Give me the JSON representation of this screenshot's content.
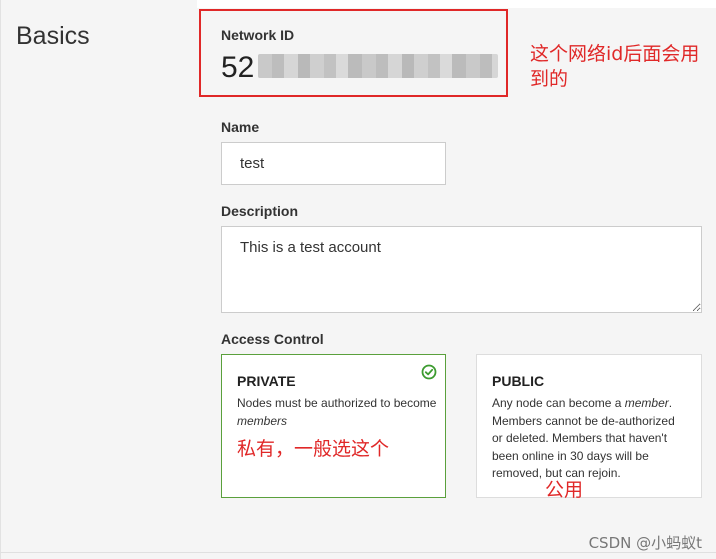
{
  "section": {
    "title": "Basics"
  },
  "network_id": {
    "label": "Network ID",
    "visible_prefix": "52"
  },
  "annotations": {
    "network_id_note": "这个网络id后面会用到的",
    "private_note": "私有，一般选这个",
    "public_note": "公用"
  },
  "name_field": {
    "label": "Name",
    "value": "test"
  },
  "description_field": {
    "label": "Description",
    "value": "This is a test account"
  },
  "access_control": {
    "label": "Access Control",
    "selected": "private",
    "options": [
      {
        "key": "private",
        "title": "PRIVATE",
        "desc_before": "Nodes must be authorized to become ",
        "desc_em": "members",
        "desc_after": ""
      },
      {
        "key": "public",
        "title": "PUBLIC",
        "desc_before": "Any node can become a ",
        "desc_em": "member",
        "desc_after": ". Members cannot be de-authorized or deleted. Members that haven't been online in 30 days will be removed, but can rejoin."
      }
    ]
  },
  "colors": {
    "annotation_red": "#e02828",
    "selected_green": "#5aa03c"
  },
  "icons": {
    "selected": "check-circle-icon"
  },
  "watermark": "CSDN @小蚂蚁t"
}
